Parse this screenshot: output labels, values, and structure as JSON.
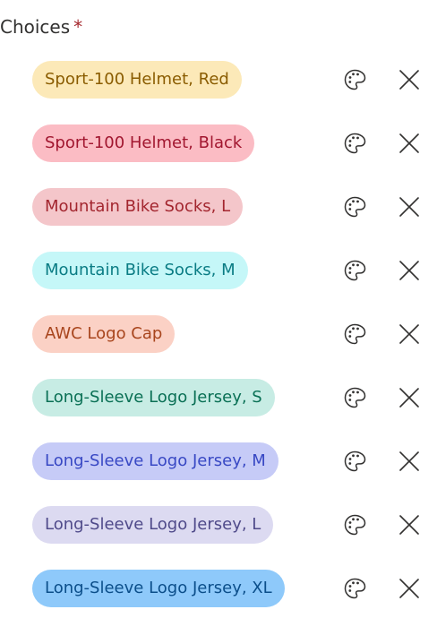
{
  "header": {
    "label": "Choices",
    "required_marker": "*"
  },
  "icons": {
    "palette": "palette-icon",
    "remove": "close-icon"
  },
  "choices": [
    {
      "label": "Sport-100 Helmet, Red",
      "bg": "#fce9b8",
      "fg": "#8a5c00"
    },
    {
      "label": "Sport-100 Helmet, Black",
      "bg": "#fbbcc4",
      "fg": "#a1162f"
    },
    {
      "label": "Mountain Bike Socks, L",
      "bg": "#f4c6ca",
      "fg": "#a3262f"
    },
    {
      "label": "Mountain Bike Socks, M",
      "bg": "#c5f7f8",
      "fg": "#0a7c84"
    },
    {
      "label": "AWC Logo Cap",
      "bg": "#fbd1c5",
      "fg": "#a8451d"
    },
    {
      "label": "Long-Sleeve Logo Jersey, S",
      "bg": "#c7ece4",
      "fg": "#0a7055"
    },
    {
      "label": "Long-Sleeve Logo Jersey, M",
      "bg": "#c6cbf7",
      "fg": "#3848c4"
    },
    {
      "label": "Long-Sleeve Logo Jersey, L",
      "bg": "#dcdaf1",
      "fg": "#4f4a8a"
    },
    {
      "label": "Long-Sleeve Logo Jersey, XL",
      "bg": "#8ec9fa",
      "fg": "#0b4e8a"
    }
  ]
}
